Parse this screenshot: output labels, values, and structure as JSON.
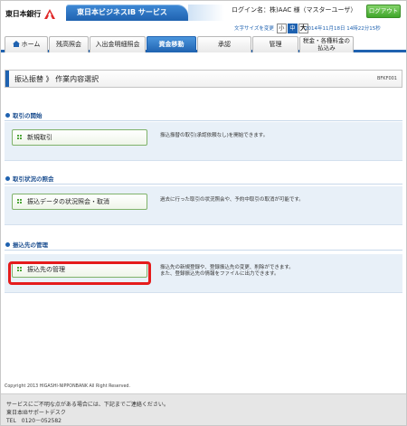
{
  "header": {
    "bank_name": "東日本銀行",
    "service_name": "東日本ビジネスIB サービス",
    "login_info": "ログイン名：株)AAC 様（マスターユーザ）",
    "logout_label": "ログアウト",
    "font_size": {
      "label": "文字サイズを変更",
      "options": [
        "小",
        "中",
        "大"
      ],
      "selected": "中"
    },
    "datetime": "2014年11月18日 14時22分15秒"
  },
  "nav": {
    "tabs": [
      {
        "label": "ホーム",
        "icon": "home-icon",
        "active": false
      },
      {
        "label": "残高照会",
        "active": false
      },
      {
        "label": "入出金明細照会",
        "active": false
      },
      {
        "label": "資金移動",
        "active": true
      },
      {
        "label": "承認",
        "active": false
      },
      {
        "label": "管理",
        "active": false
      },
      {
        "label": "税金・各種料金の払込み",
        "active": false
      }
    ]
  },
  "page": {
    "title": "振込振替 》 作業内容選択",
    "screen_id": "BFKF001"
  },
  "sections": [
    {
      "heading": "取引の開始",
      "button": "新規取引",
      "description": "振込振替の取引(承認依頼なし)を開始できます。"
    },
    {
      "heading": "取引状況の照会",
      "button": "振込データの状況照会・取消",
      "description": "過去に行った取引の状況照会や、予約中取引の取消が可能です。"
    },
    {
      "heading": "振込先の管理",
      "button": "振込先の管理",
      "description_lines": [
        "振込先の新規登録や、登録振込先の変更、削除ができます。",
        "また、登録振込先の情報をファイルに出力できます。"
      ]
    }
  ],
  "footer": {
    "copyright": "Copyright 2013 HIGASHI-NIPPONBANK All Right Reserved.",
    "lines": [
      "サービスにご不明な点がある場合には、下記までご連絡ください。",
      "東日本IBサポートデスク",
      "TEL　0120－052582"
    ]
  },
  "colors": {
    "brand_blue": "#1f62b0",
    "logout_green": "#3fa62a",
    "section_bg": "#e8f0f8",
    "highlight_red": "#e51c1c"
  }
}
